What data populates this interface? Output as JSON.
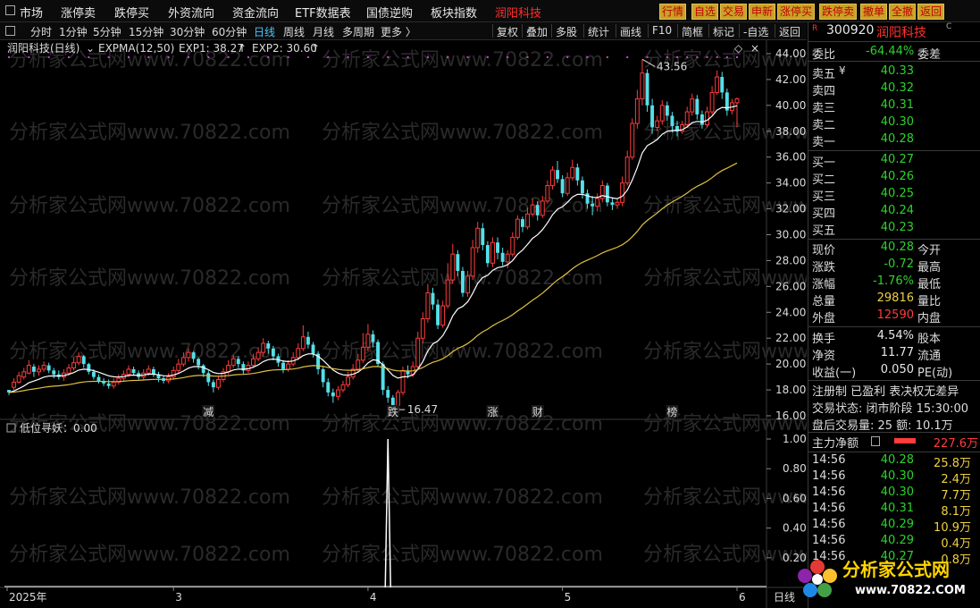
{
  "menubar": {
    "items": [
      "市场",
      "涨停卖",
      "跌停买",
      "外资流向",
      "资金流向",
      "ETF数据表",
      "国债逆购",
      "板块指数",
      "润阳科技"
    ],
    "right_buttons": [
      "行情",
      "自选",
      "交易",
      "申新",
      "涨停买",
      "跌停卖",
      "撤单",
      "全撤",
      "返回"
    ]
  },
  "toolbar": {
    "periods": [
      "分时",
      "1分钟",
      "5分钟",
      "15分钟",
      "30分钟",
      "60分钟",
      "日线",
      "周线",
      "月线",
      "多周期",
      "更多 〉"
    ],
    "active_period": "日线",
    "right_items": [
      "复权",
      "叠加",
      "多股",
      "统计",
      "画线",
      "F10",
      "简框",
      "标记",
      "-自选",
      "返回"
    ]
  },
  "chart": {
    "title": "润阳科技(日线)",
    "indicator_name": "EXPMA(12,50)",
    "exp1_label": "EXP1: 38.27",
    "exp2_label": "EXP2: 30.60",
    "high_annotation": "43.56",
    "low_annotation": "16.47",
    "event_tags": [
      {
        "text": "减",
        "color": "#2ed12e",
        "day": 40
      },
      {
        "text": "跌",
        "color": "#2ed12e",
        "day": 77
      },
      {
        "text": "涨",
        "color": "#ff3c3c",
        "day": 97
      },
      {
        "text": "财",
        "color": "#48c8ff",
        "day": 106
      },
      {
        "text": "榜",
        "color": "#f0a030",
        "day": 133
      }
    ],
    "y_ticks": [
      "44.00",
      "42.00",
      "40.00",
      "38.00",
      "36.00",
      "34.00",
      "32.00",
      "30.00",
      "28.00",
      "26.00",
      "24.00",
      "22.00",
      "20.00",
      "18.00",
      "16.00"
    ],
    "sub_title": "低位寻妖：0.00",
    "sub_y_ticks": [
      "1.00",
      "0.80",
      "0.60",
      "0.40",
      "0.20"
    ],
    "x_labels": [
      {
        "text": "2025年",
        "day": 0
      },
      {
        "text": "3",
        "day": 33
      },
      {
        "text": "4",
        "day": 72
      },
      {
        "text": "5",
        "day": 111
      },
      {
        "text": "6",
        "day": 146
      }
    ],
    "x_axis_end_label": "日线",
    "watermark": "分析家公式网www.70822.com"
  },
  "chart_data": {
    "type": "candlestick",
    "title": "润阳科技(日线)",
    "ylim": [
      16,
      44
    ],
    "ohlc": [
      [
        18.0,
        17.8,
        18.0,
        17.6
      ],
      [
        18.2,
        18.6,
        18.9,
        18.0
      ],
      [
        18.6,
        19.1,
        19.4,
        18.5
      ],
      [
        19.0,
        19.4,
        19.7,
        18.8
      ],
      [
        19.3,
        19.9,
        20.3,
        19.2
      ],
      [
        19.8,
        19.4,
        20.0,
        19.0
      ],
      [
        19.4,
        19.6,
        19.9,
        19.1
      ],
      [
        19.6,
        19.9,
        20.2,
        19.4
      ],
      [
        19.9,
        19.5,
        20.1,
        19.3
      ],
      [
        19.5,
        19.2,
        19.7,
        18.9
      ],
      [
        19.2,
        19.0,
        19.5,
        18.8
      ],
      [
        19.0,
        19.3,
        19.6,
        18.7
      ],
      [
        19.3,
        19.7,
        20.0,
        19.1
      ],
      [
        19.7,
        20.1,
        20.5,
        19.5
      ],
      [
        20.1,
        20.6,
        20.9,
        19.9
      ],
      [
        20.6,
        20.0,
        20.7,
        19.7
      ],
      [
        20.0,
        19.4,
        20.1,
        19.2
      ],
      [
        19.4,
        19.0,
        19.6,
        18.8
      ],
      [
        19.0,
        18.7,
        19.2,
        18.5
      ],
      [
        18.7,
        18.5,
        18.9,
        18.3
      ],
      [
        18.5,
        18.3,
        18.8,
        18.1
      ],
      [
        18.3,
        18.6,
        18.9,
        18.1
      ],
      [
        18.6,
        18.9,
        19.2,
        18.4
      ],
      [
        18.9,
        19.2,
        19.5,
        18.7
      ],
      [
        19.2,
        19.6,
        19.9,
        19.0
      ],
      [
        19.6,
        19.3,
        19.8,
        19.1
      ],
      [
        19.3,
        19.0,
        19.5,
        18.8
      ],
      [
        19.0,
        19.3,
        19.6,
        18.8
      ],
      [
        19.3,
        19.6,
        19.9,
        19.1
      ],
      [
        19.6,
        19.2,
        19.8,
        19.0
      ],
      [
        19.2,
        18.9,
        19.4,
        18.6
      ],
      [
        18.9,
        18.7,
        19.1,
        18.5
      ],
      [
        18.7,
        19.0,
        19.3,
        18.5
      ],
      [
        19.0,
        19.5,
        19.8,
        18.8
      ],
      [
        19.5,
        20.0,
        20.4,
        19.3
      ],
      [
        20.0,
        20.5,
        20.9,
        19.8
      ],
      [
        20.5,
        20.9,
        21.2,
        20.2
      ],
      [
        20.9,
        20.4,
        21.0,
        20.1
      ],
      [
        20.4,
        19.9,
        20.5,
        19.6
      ],
      [
        19.9,
        19.3,
        20.0,
        19.0
      ],
      [
        19.3,
        18.6,
        19.5,
        18.3
      ],
      [
        18.6,
        18.2,
        18.8,
        17.8
      ],
      [
        18.2,
        18.8,
        19.1,
        18.0
      ],
      [
        18.8,
        19.4,
        19.7,
        18.6
      ],
      [
        19.4,
        19.9,
        20.3,
        19.2
      ],
      [
        19.9,
        20.4,
        20.7,
        19.7
      ],
      [
        20.4,
        20.0,
        20.6,
        19.7
      ],
      [
        20.0,
        19.5,
        20.2,
        19.2
      ],
      [
        19.5,
        19.9,
        20.2,
        19.3
      ],
      [
        19.9,
        20.4,
        20.8,
        19.7
      ],
      [
        20.4,
        20.9,
        21.3,
        20.2
      ],
      [
        20.9,
        21.6,
        22.0,
        20.6
      ],
      [
        21.6,
        21.2,
        21.8,
        20.8
      ],
      [
        21.2,
        20.6,
        21.4,
        20.3
      ],
      [
        20.6,
        20.1,
        20.8,
        19.8
      ],
      [
        20.1,
        19.6,
        20.3,
        19.3
      ],
      [
        19.6,
        20.0,
        20.3,
        19.4
      ],
      [
        20.0,
        20.5,
        20.9,
        19.8
      ],
      [
        20.5,
        21.2,
        21.6,
        20.3
      ],
      [
        21.2,
        22.1,
        23.0,
        21.0
      ],
      [
        22.1,
        21.5,
        22.5,
        21.2
      ],
      [
        21.5,
        20.8,
        21.7,
        20.5
      ],
      [
        20.8,
        19.6,
        21.0,
        19.2
      ],
      [
        19.6,
        18.6,
        19.8,
        18.2
      ],
      [
        18.6,
        17.8,
        18.9,
        17.5
      ],
      [
        17.8,
        17.5,
        18.1,
        17.0
      ],
      [
        17.5,
        18.0,
        18.3,
        17.2
      ],
      [
        18.0,
        18.4,
        18.7,
        17.8
      ],
      [
        18.4,
        19.0,
        19.4,
        18.2
      ],
      [
        19.0,
        19.6,
        20.0,
        18.8
      ],
      [
        19.6,
        20.3,
        20.8,
        19.4
      ],
      [
        20.3,
        21.3,
        22.4,
        20.1
      ],
      [
        21.3,
        22.3,
        23.1,
        21.0
      ],
      [
        22.3,
        21.7,
        22.6,
        21.3
      ],
      [
        21.7,
        20.0,
        21.9,
        19.8
      ],
      [
        20.0,
        18.0,
        20.2,
        17.6
      ],
      [
        18.0,
        17.4,
        18.3,
        17.0
      ],
      [
        17.4,
        16.8,
        17.6,
        16.47
      ],
      [
        16.8,
        17.8,
        18.0,
        16.6
      ],
      [
        17.8,
        19.5,
        19.8,
        17.6
      ],
      [
        19.5,
        19.2,
        19.9,
        18.9
      ],
      [
        19.2,
        19.8,
        20.2,
        19.0
      ],
      [
        19.8,
        22.0,
        22.5,
        19.6
      ],
      [
        22.0,
        23.5,
        24.0,
        21.6
      ],
      [
        23.5,
        25.5,
        26.2,
        23.2
      ],
      [
        25.5,
        24.6,
        25.9,
        24.2
      ],
      [
        24.6,
        23.0,
        25.0,
        22.7
      ],
      [
        23.0,
        24.5,
        24.9,
        22.8
      ],
      [
        24.5,
        26.5,
        27.8,
        24.3
      ],
      [
        26.5,
        28.5,
        29.3,
        26.2
      ],
      [
        28.5,
        27.2,
        28.8,
        26.8
      ],
      [
        27.2,
        25.5,
        27.5,
        25.2
      ],
      [
        25.5,
        26.8,
        27.2,
        25.2
      ],
      [
        26.8,
        29.0,
        29.6,
        26.5
      ],
      [
        29.0,
        30.5,
        31.0,
        28.6
      ],
      [
        30.5,
        29.2,
        30.9,
        28.8
      ],
      [
        29.2,
        27.8,
        29.5,
        27.5
      ],
      [
        27.8,
        29.4,
        29.8,
        27.5
      ],
      [
        29.4,
        28.6,
        29.8,
        28.1
      ],
      [
        28.6,
        27.9,
        29.0,
        27.6
      ],
      [
        27.9,
        28.5,
        28.8,
        27.4
      ],
      [
        28.5,
        29.8,
        30.2,
        28.3
      ],
      [
        29.8,
        31.2,
        31.5,
        29.6
      ],
      [
        31.2,
        30.6,
        31.4,
        30.2
      ],
      [
        30.6,
        31.6,
        32.1,
        30.4
      ],
      [
        31.6,
        32.3,
        32.8,
        31.4
      ],
      [
        32.3,
        31.5,
        32.6,
        31.1
      ],
      [
        31.5,
        32.6,
        33.0,
        31.3
      ],
      [
        32.6,
        33.8,
        34.2,
        32.4
      ],
      [
        33.8,
        35.0,
        35.3,
        33.5
      ],
      [
        35.0,
        34.3,
        35.7,
        34.0
      ],
      [
        34.3,
        33.2,
        34.6,
        32.9
      ],
      [
        33.2,
        34.4,
        34.8,
        33.0
      ],
      [
        34.4,
        35.2,
        35.8,
        34.2
      ],
      [
        35.2,
        34.2,
        35.5,
        33.8
      ],
      [
        34.2,
        33.2,
        34.5,
        32.8
      ],
      [
        33.2,
        32.4,
        33.5,
        32.0
      ],
      [
        32.4,
        32.2,
        33.0,
        31.5
      ],
      [
        32.2,
        32.8,
        33.2,
        31.8
      ],
      [
        32.8,
        33.8,
        34.2,
        32.5
      ],
      [
        33.8,
        32.5,
        34.0,
        32.2
      ],
      [
        32.5,
        32.3,
        32.9,
        31.9
      ],
      [
        32.3,
        32.5,
        32.8,
        32.0
      ],
      [
        32.5,
        34.0,
        34.5,
        32.2
      ],
      [
        34.0,
        36.0,
        36.5,
        33.8
      ],
      [
        36.0,
        38.6,
        39.0,
        35.8
      ],
      [
        38.6,
        40.5,
        41.2,
        38.2
      ],
      [
        40.5,
        42.5,
        43.56,
        40.0
      ],
      [
        42.5,
        40.0,
        42.8,
        39.5
      ],
      [
        40.0,
        38.3,
        40.5,
        37.8
      ],
      [
        38.3,
        38.8,
        39.2,
        38.0
      ],
      [
        38.8,
        40.0,
        40.4,
        38.5
      ],
      [
        40.0,
        39.2,
        40.3,
        38.8
      ],
      [
        39.2,
        38.4,
        39.5,
        37.9
      ],
      [
        38.4,
        38.0,
        38.8,
        37.6
      ],
      [
        38.0,
        38.5,
        38.8,
        37.8
      ],
      [
        38.5,
        39.5,
        39.9,
        38.3
      ],
      [
        39.5,
        40.5,
        40.9,
        39.2
      ],
      [
        40.5,
        39.3,
        40.8,
        38.9
      ],
      [
        39.3,
        38.5,
        39.6,
        38.2
      ],
      [
        38.5,
        39.5,
        39.9,
        38.3
      ],
      [
        39.5,
        41.0,
        41.5,
        39.3
      ],
      [
        41.0,
        42.2,
        42.7,
        40.8
      ],
      [
        42.2,
        41.0,
        42.6,
        40.5
      ],
      [
        41.0,
        39.6,
        41.3,
        39.2
      ],
      [
        39.6,
        40.2,
        40.5,
        39.3
      ],
      [
        40.2,
        40.5,
        40.6,
        38.3
      ]
    ],
    "series": [
      {
        "name": "EXP1",
        "last": 38.27
      },
      {
        "name": "EXP2",
        "last": 30.6
      }
    ]
  },
  "panel": {
    "code": "300920",
    "name": "润阳科技",
    "weibi_label": "委比",
    "weibi_value": "-64.44%",
    "weicha_label": "委差",
    "asks": [
      {
        "label": "卖五",
        "price": "40.33"
      },
      {
        "label": "卖四",
        "price": "40.32"
      },
      {
        "label": "卖三",
        "price": "40.31"
      },
      {
        "label": "卖二",
        "price": "40.30"
      },
      {
        "label": "卖一",
        "price": "40.28"
      }
    ],
    "bids": [
      {
        "label": "买一",
        "price": "40.27"
      },
      {
        "label": "买二",
        "price": "40.26"
      },
      {
        "label": "买三",
        "price": "40.25"
      },
      {
        "label": "买四",
        "price": "40.24"
      },
      {
        "label": "买五",
        "price": "40.23"
      }
    ],
    "stats": [
      {
        "l": "现价",
        "v": "40.28",
        "vc": "green",
        "r": "今开"
      },
      {
        "l": "涨跌",
        "v": "-0.72",
        "vc": "green",
        "r": "最高"
      },
      {
        "l": "涨幅",
        "v": "-1.76%",
        "vc": "green",
        "r": "最低"
      },
      {
        "l": "总量",
        "v": "29816",
        "vc": "yellow",
        "r": "量比"
      },
      {
        "l": "外盘",
        "v": "12590",
        "vc": "red",
        "r": "内盘"
      }
    ],
    "stats2": [
      {
        "l": "换手",
        "v": "4.54%",
        "vc": "white",
        "r": "股本"
      },
      {
        "l": "净资",
        "v": "11.77",
        "vc": "white",
        "r": "流通"
      },
      {
        "l": "收益(一)",
        "v": "0.050",
        "vc": "white",
        "r": "PE(动)"
      }
    ],
    "reg_text": "注册制 已盈利 表决权无差异",
    "trade_state": "交易状态: 闭市阶段 15:30:00",
    "after_hours": "盘后交易量: 25  额: 10.1万",
    "main_flow_label": "主力净额",
    "main_flow_value": "227.6万",
    "ticks": [
      {
        "t": "14:56",
        "p": "40.28",
        "v": "25.8万"
      },
      {
        "t": "14:56",
        "p": "40.30",
        "v": "2.4万"
      },
      {
        "t": "14:56",
        "p": "40.30",
        "v": "7.7万"
      },
      {
        "t": "14:56",
        "p": "40.31",
        "v": "8.1万"
      },
      {
        "t": "14:56",
        "p": "40.29",
        "v": "10.9万"
      },
      {
        "t": "14:56",
        "p": "40.29",
        "v": "0.4万"
      },
      {
        "t": "14:56",
        "p": "40.27",
        "v": "0.8万"
      }
    ]
  },
  "logo": {
    "title": "分析家公式网",
    "url": "www.70822.COM"
  }
}
